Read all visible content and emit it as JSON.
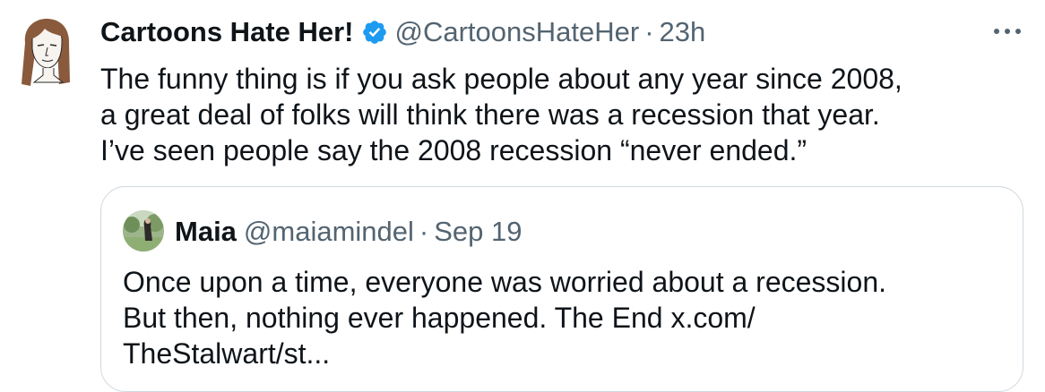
{
  "tweet": {
    "author_name": "Cartoons Hate Her!",
    "handle": "@CartoonsHateHer",
    "separator": "·",
    "time": "23h",
    "verified": true,
    "text_lines": [
      "The funny thing is if you ask people about any year since 2008,",
      "a great deal of folks will think there was a recession that year.",
      "I’ve seen people say the 2008 recession “never ended.”"
    ]
  },
  "quoted": {
    "author_name": "Maia",
    "handle": "@maiamindel",
    "separator": "·",
    "time": "Sep 19",
    "text_line1": "Once upon a time, everyone was worried about a recession.",
    "text_line2_prefix": "But then, nothing ever happened. The End ",
    "link_part1": "x.com/",
    "link_part2": "TheStalwart/st..."
  },
  "colors": {
    "primary_text": "#0f1419",
    "secondary_text": "#536471",
    "verified_blue": "#1d9bf0",
    "border": "#cfd9de"
  },
  "icons": {
    "verified": "verified-badge-icon",
    "more": "more-options-icon"
  }
}
